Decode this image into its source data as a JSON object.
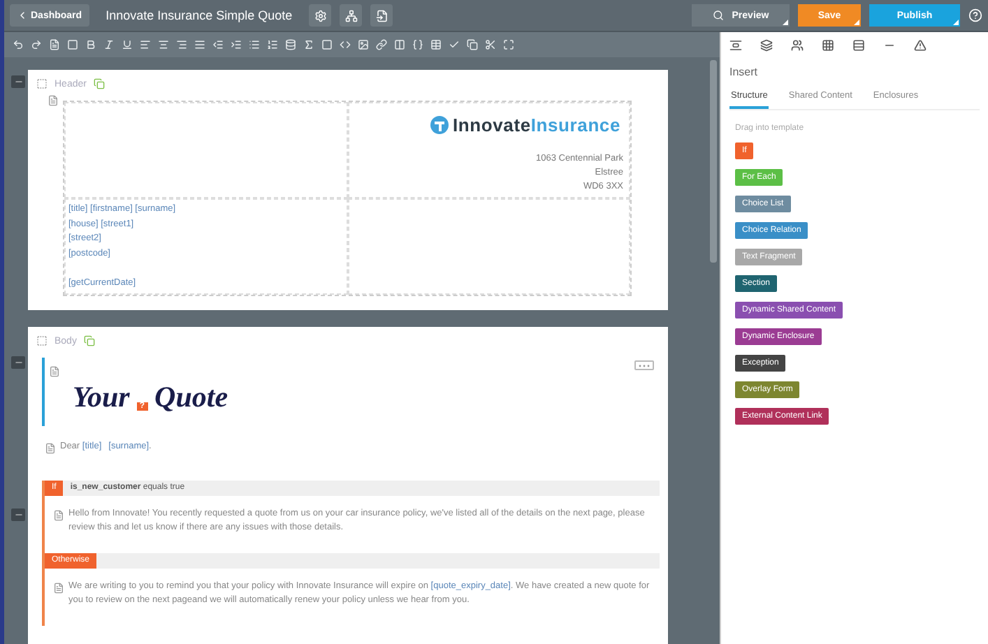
{
  "topbar": {
    "back": "Dashboard",
    "title": "Innovate Insurance Simple Quote",
    "preview": "Preview",
    "save": "Save",
    "publish": "Publish"
  },
  "header_section": {
    "label": "Header",
    "logo": {
      "first": "Innovate",
      "second": "Insurance"
    },
    "address": [
      "1063 Centennial Park",
      "Elstree",
      "WD6 3XX"
    ],
    "recipient": [
      {
        "kind": "line",
        "text": "[title] [firstname] [surname]"
      },
      {
        "kind": "line",
        "text": "[house] [street1]"
      },
      {
        "kind": "line",
        "text": "[street2]"
      },
      {
        "kind": "line",
        "text": "[postcode]"
      },
      {
        "kind": "spaced_line",
        "text": "[getCurrentDate]"
      }
    ]
  },
  "body_section": {
    "label": "Body",
    "heading": {
      "first": "Your",
      "badge": "?",
      "second": "Quote"
    },
    "greeting": [
      {
        "kind": "text",
        "text": "Dear "
      },
      {
        "kind": "field",
        "text": "[title]"
      },
      {
        "kind": "field",
        "text": "[surname]"
      },
      {
        "kind": "text",
        "text": "."
      }
    ],
    "condition": {
      "tag": "If",
      "expression": "**is_new_customer** equals true",
      "then": [
        {
          "kind": "text",
          "text": "Hello from Innovate! You recently requested a quote from us on your car insurance policy, we've listed all of the details on the next page, please review this and let us know if there are any issues with those details."
        }
      ],
      "else_tag": "Otherwise",
      "else": [
        {
          "kind": "text",
          "text": "We are writing to you to remind you that your policy with Innovate Insurance will expire on "
        },
        {
          "kind": "field",
          "text": "[quote_expiry_date]"
        },
        {
          "kind": "text",
          "text": ".  We have created a new quote for you to review on the next pageand we will automatically renew your policy unless we hear from you."
        }
      ]
    }
  },
  "panel": {
    "title": "Insert",
    "tabs": [
      {
        "label": "Structure",
        "selected": true
      },
      {
        "label": "Shared Content",
        "selected": false
      },
      {
        "label": "Enclosures",
        "selected": false
      }
    ],
    "hint": "Drag into template",
    "items": [
      {
        "label": "If",
        "color": "#f0622d"
      },
      {
        "label": "For Each",
        "color": "#5cbf46"
      },
      {
        "label": "Choice List",
        "color": "#6e8ca0"
      },
      {
        "label": "Choice Relation",
        "color": "#3a8fc7"
      },
      {
        "label": "Text Fragment",
        "color": "#a8a8a8"
      },
      {
        "label": "Section",
        "color": "#1f6470"
      },
      {
        "label": "Dynamic Shared Content",
        "color": "#8a4fb0"
      },
      {
        "label": "Dynamic Enclosure",
        "color": "#9b3c93"
      },
      {
        "label": "Exception",
        "color": "#444444"
      },
      {
        "label": "Overlay Form",
        "color": "#7d8630"
      },
      {
        "label": "External Content Link",
        "color": "#b0305a"
      }
    ]
  }
}
